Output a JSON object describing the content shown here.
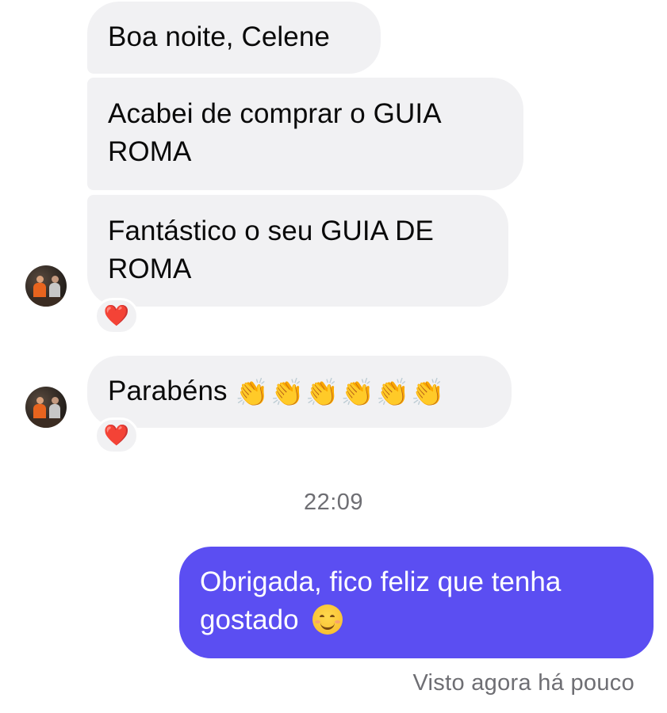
{
  "incoming_messages": [
    {
      "text": "Boa noite, Celene"
    },
    {
      "text": "Acabei de comprar o GUIA ROMA"
    },
    {
      "text": "Fantástico o seu GUIA DE ROMA",
      "reaction": "❤️"
    },
    {
      "text": "Parabéns",
      "emoji": "👏👏👏👏👏👏",
      "reaction": "❤️"
    }
  ],
  "timestamp": "22:09",
  "outgoing_message": {
    "text": "Obrigada, fico feliz que tenha gostado",
    "emoji": "😊"
  },
  "seen_status": "Visto agora há pouco",
  "colors": {
    "incoming_bubble": "#f1f1f3",
    "outgoing_bubble": "#5b4ef2",
    "outgoing_text": "#ffffff",
    "meta_text": "#6e6e73",
    "reaction_heart": "#e3262f"
  },
  "icons": {
    "avatar": "contact-photo",
    "reaction": "red-heart",
    "applause": "clapping-hands-emoji",
    "smile": "smiling-face-emoji"
  }
}
